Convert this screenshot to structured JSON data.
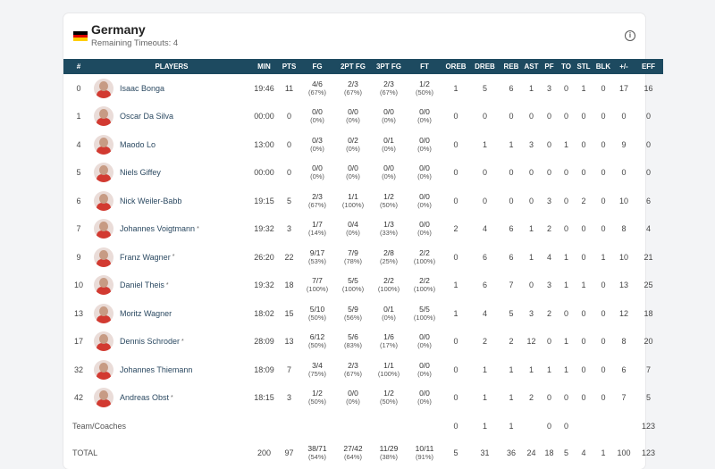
{
  "team": {
    "name": "Germany",
    "subtitle": "Remaining Timeouts: 4",
    "flag_colors": [
      "#000000",
      "#dd0000",
      "#ffce00"
    ]
  },
  "columns": [
    "#",
    "PLAYERS",
    "MIN",
    "PTS",
    "FG",
    "2PT FG",
    "3PT FG",
    "FT",
    "OREB",
    "DREB",
    "REB",
    "AST",
    "PF",
    "TO",
    "STL",
    "BLK",
    "+/-",
    "EFF"
  ],
  "players": [
    {
      "num": "0",
      "name": "Isaac Bonga",
      "star": "",
      "min": "19:46",
      "pts": "11",
      "fg": "4/6",
      "fg_pct": "(67%)",
      "fg2": "2/3",
      "fg2_pct": "(67%)",
      "fg3": "2/3",
      "fg3_pct": "(67%)",
      "ft": "1/2",
      "ft_pct": "(50%)",
      "oreb": "1",
      "dreb": "5",
      "reb": "6",
      "ast": "1",
      "pf": "3",
      "to": "0",
      "stl": "1",
      "blk": "0",
      "pm": "17",
      "eff": "16"
    },
    {
      "num": "1",
      "name": "Oscar Da Silva",
      "star": "",
      "min": "00:00",
      "pts": "0",
      "fg": "0/0",
      "fg_pct": "(0%)",
      "fg2": "0/0",
      "fg2_pct": "(0%)",
      "fg3": "0/0",
      "fg3_pct": "(0%)",
      "ft": "0/0",
      "ft_pct": "(0%)",
      "oreb": "0",
      "dreb": "0",
      "reb": "0",
      "ast": "0",
      "pf": "0",
      "to": "0",
      "stl": "0",
      "blk": "0",
      "pm": "0",
      "eff": "0"
    },
    {
      "num": "4",
      "name": "Maodo Lo",
      "star": "",
      "min": "13:00",
      "pts": "0",
      "fg": "0/3",
      "fg_pct": "(0%)",
      "fg2": "0/2",
      "fg2_pct": "(0%)",
      "fg3": "0/1",
      "fg3_pct": "(0%)",
      "ft": "0/0",
      "ft_pct": "(0%)",
      "oreb": "0",
      "dreb": "1",
      "reb": "1",
      "ast": "3",
      "pf": "0",
      "to": "1",
      "stl": "0",
      "blk": "0",
      "pm": "9",
      "eff": "0"
    },
    {
      "num": "5",
      "name": "Niels Giffey",
      "star": "",
      "min": "00:00",
      "pts": "0",
      "fg": "0/0",
      "fg_pct": "(0%)",
      "fg2": "0/0",
      "fg2_pct": "(0%)",
      "fg3": "0/0",
      "fg3_pct": "(0%)",
      "ft": "0/0",
      "ft_pct": "(0%)",
      "oreb": "0",
      "dreb": "0",
      "reb": "0",
      "ast": "0",
      "pf": "0",
      "to": "0",
      "stl": "0",
      "blk": "0",
      "pm": "0",
      "eff": "0"
    },
    {
      "num": "6",
      "name": "Nick Weiler-Babb",
      "star": "",
      "min": "19:15",
      "pts": "5",
      "fg": "2/3",
      "fg_pct": "(67%)",
      "fg2": "1/1",
      "fg2_pct": "(100%)",
      "fg3": "1/2",
      "fg3_pct": "(50%)",
      "ft": "0/0",
      "ft_pct": "(0%)",
      "oreb": "0",
      "dreb": "0",
      "reb": "0",
      "ast": "0",
      "pf": "3",
      "to": "0",
      "stl": "2",
      "blk": "0",
      "pm": "10",
      "eff": "6"
    },
    {
      "num": "7",
      "name": "Johannes Voigtmann",
      "star": "*",
      "min": "19:32",
      "pts": "3",
      "fg": "1/7",
      "fg_pct": "(14%)",
      "fg2": "0/4",
      "fg2_pct": "(0%)",
      "fg3": "1/3",
      "fg3_pct": "(33%)",
      "ft": "0/0",
      "ft_pct": "(0%)",
      "oreb": "2",
      "dreb": "4",
      "reb": "6",
      "ast": "1",
      "pf": "2",
      "to": "0",
      "stl": "0",
      "blk": "0",
      "pm": "8",
      "eff": "4"
    },
    {
      "num": "9",
      "name": "Franz Wagner",
      "star": "*",
      "min": "26:20",
      "pts": "22",
      "fg": "9/17",
      "fg_pct": "(53%)",
      "fg2": "7/9",
      "fg2_pct": "(78%)",
      "fg3": "2/8",
      "fg3_pct": "(25%)",
      "ft": "2/2",
      "ft_pct": "(100%)",
      "oreb": "0",
      "dreb": "6",
      "reb": "6",
      "ast": "1",
      "pf": "4",
      "to": "1",
      "stl": "0",
      "blk": "1",
      "pm": "10",
      "eff": "21"
    },
    {
      "num": "10",
      "name": "Daniel Theis",
      "star": "*",
      "min": "19:32",
      "pts": "18",
      "fg": "7/7",
      "fg_pct": "(100%)",
      "fg2": "5/5",
      "fg2_pct": "(100%)",
      "fg3": "2/2",
      "fg3_pct": "(100%)",
      "ft": "2/2",
      "ft_pct": "(100%)",
      "oreb": "1",
      "dreb": "6",
      "reb": "7",
      "ast": "0",
      "pf": "3",
      "to": "1",
      "stl": "1",
      "blk": "0",
      "pm": "13",
      "eff": "25"
    },
    {
      "num": "13",
      "name": "Moritz Wagner",
      "star": "",
      "min": "18:02",
      "pts": "15",
      "fg": "5/10",
      "fg_pct": "(50%)",
      "fg2": "5/9",
      "fg2_pct": "(56%)",
      "fg3": "0/1",
      "fg3_pct": "(0%)",
      "ft": "5/5",
      "ft_pct": "(100%)",
      "oreb": "1",
      "dreb": "4",
      "reb": "5",
      "ast": "3",
      "pf": "2",
      "to": "0",
      "stl": "0",
      "blk": "0",
      "pm": "12",
      "eff": "18"
    },
    {
      "num": "17",
      "name": "Dennis Schroder",
      "star": "*",
      "min": "28:09",
      "pts": "13",
      "fg": "6/12",
      "fg_pct": "(50%)",
      "fg2": "5/6",
      "fg2_pct": "(83%)",
      "fg3": "1/6",
      "fg3_pct": "(17%)",
      "ft": "0/0",
      "ft_pct": "(0%)",
      "oreb": "0",
      "dreb": "2",
      "reb": "2",
      "ast": "12",
      "pf": "0",
      "to": "1",
      "stl": "0",
      "blk": "0",
      "pm": "8",
      "eff": "20"
    },
    {
      "num": "32",
      "name": "Johannes Thiemann",
      "star": "",
      "min": "18:09",
      "pts": "7",
      "fg": "3/4",
      "fg_pct": "(75%)",
      "fg2": "2/3",
      "fg2_pct": "(67%)",
      "fg3": "1/1",
      "fg3_pct": "(100%)",
      "ft": "0/0",
      "ft_pct": "(0%)",
      "oreb": "0",
      "dreb": "1",
      "reb": "1",
      "ast": "1",
      "pf": "1",
      "to": "1",
      "stl": "0",
      "blk": "0",
      "pm": "6",
      "eff": "7"
    },
    {
      "num": "42",
      "name": "Andreas Obst",
      "star": "*",
      "min": "18:15",
      "pts": "3",
      "fg": "1/2",
      "fg_pct": "(50%)",
      "fg2": "0/0",
      "fg2_pct": "(0%)",
      "fg3": "1/2",
      "fg3_pct": "(50%)",
      "ft": "0/0",
      "ft_pct": "(0%)",
      "oreb": "0",
      "dreb": "1",
      "reb": "1",
      "ast": "2",
      "pf": "0",
      "to": "0",
      "stl": "0",
      "blk": "0",
      "pm": "7",
      "eff": "5"
    }
  ],
  "team_coaches": {
    "label": "Team/Coaches",
    "oreb": "0",
    "dreb": "1",
    "reb": "1",
    "pf": "0",
    "to": "0",
    "eff": "123"
  },
  "total": {
    "label": "TOTAL",
    "min": "200",
    "pts": "97",
    "fg": "38/71",
    "fg_pct": "(54%)",
    "fg2": "27/42",
    "fg2_pct": "(64%)",
    "fg3": "11/29",
    "fg3_pct": "(38%)",
    "ft": "10/11",
    "ft_pct": "(91%)",
    "oreb": "5",
    "dreb": "31",
    "reb": "36",
    "ast": "24",
    "pf": "18",
    "to": "5",
    "stl": "4",
    "blk": "1",
    "pm": "100",
    "eff": "123"
  }
}
